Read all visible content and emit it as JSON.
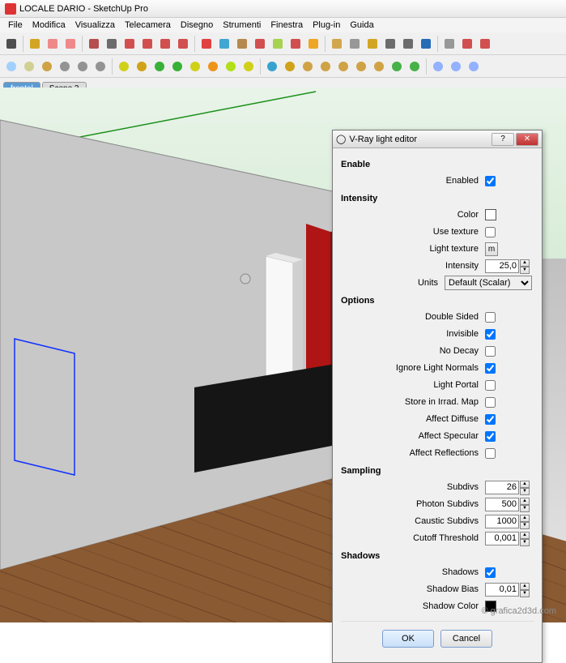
{
  "titlebar": {
    "text": "LOCALE DARIO - SketchUp Pro"
  },
  "menus": [
    "File",
    "Modifica",
    "Visualizza",
    "Telecamera",
    "Disegno",
    "Strumenti",
    "Finestra",
    "Plug-in",
    "Guida"
  ],
  "tabs": [
    {
      "label": "frontal",
      "active": true
    },
    {
      "label": "Scene 2",
      "active": false
    }
  ],
  "toolbars": {
    "row1_icons": [
      "select-icon",
      "paintbucket-icon",
      "eraser-icon",
      "eraser-icon",
      "pencil-icon",
      "line-icon",
      "protractor-icon",
      "arc-icon",
      "arc2-icon",
      "freehand-icon",
      "move-icon",
      "rotate-icon",
      "scale-icon",
      "offset-icon",
      "pushpull-icon",
      "followme-icon",
      "section-icon",
      "axes-icon",
      "tape-icon",
      "dimension-icon",
      "text-icon",
      "text3d-icon",
      "walk-icon",
      "look-icon",
      "plugin-icon",
      "plugin-icon"
    ],
    "row2_icons": [
      "new-icon",
      "open-icon",
      "save-icon",
      "home-icon",
      "undo-icon",
      "redo-icon",
      "m-icon",
      "m-icon",
      "r-icon",
      "rt-icon",
      "sphere-y-icon",
      "sphere-o-icon",
      "sphere-l-icon",
      "sphere-y-icon",
      "arrow-icon",
      "xray-icon",
      "hat-icon",
      "hat-icon",
      "hat-icon",
      "hat-icon",
      "hat-icon",
      "tree-icon",
      "tree-icon",
      "iso-icon",
      "front-icon",
      "top-icon"
    ]
  },
  "dialog": {
    "title": "V-Ray light editor",
    "enable": {
      "header": "Enable",
      "enabled_label": "Enabled",
      "enabled": true
    },
    "intensity": {
      "header": "Intensity",
      "color_label": "Color",
      "use_texture_label": "Use texture",
      "use_texture": false,
      "light_texture_label": "Light texture",
      "light_texture_btn": "m",
      "intensity_label": "Intensity",
      "intensity_value": "25,0",
      "units_label": "Units",
      "units_value": "Default (Scalar)"
    },
    "options": {
      "header": "Options",
      "double_sided_label": "Double Sided",
      "double_sided": false,
      "invisible_label": "Invisible",
      "invisible": true,
      "no_decay_label": "No Decay",
      "no_decay": false,
      "ignore_normals_label": "Ignore Light Normals",
      "ignore_normals": true,
      "light_portal_label": "Light Portal",
      "light_portal": false,
      "store_irrad_label": "Store in Irrad. Map",
      "store_irrad": false,
      "affect_diffuse_label": "Affect Diffuse",
      "affect_diffuse": true,
      "affect_specular_label": "Affect Specular",
      "affect_specular": true,
      "affect_reflections_label": "Affect Reflections",
      "affect_reflections": false
    },
    "sampling": {
      "header": "Sampling",
      "subdivs_label": "Subdivs",
      "subdivs": "26",
      "photon_label": "Photon Subdivs",
      "photon": "500",
      "caustic_label": "Caustic Subdivs",
      "caustic": "1000",
      "cutoff_label": "Cutoff Threshold",
      "cutoff": "0,001"
    },
    "shadows": {
      "header": "Shadows",
      "shadows_label": "Shadows",
      "shadows": true,
      "bias_label": "Shadow Bias",
      "bias": "0,01",
      "color_label": "Shadow Color"
    },
    "buttons": {
      "ok": "OK",
      "cancel": "Cancel"
    }
  },
  "watermark": "© grafica2d3d.com"
}
